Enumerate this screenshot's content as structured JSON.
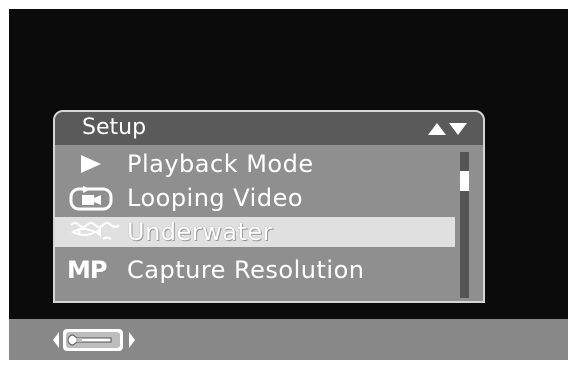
{
  "menu": {
    "title": "Setup",
    "scroll_icon": "up-down-triangles-icon",
    "items": [
      {
        "label": "Playback Mode",
        "icon": "play-icon"
      },
      {
        "label": "Looping Video",
        "icon": "looping-video-icon"
      },
      {
        "label": "Underwater",
        "icon": "underwater-fish-icon",
        "selected": true
      },
      {
        "label": "Capture Resolution",
        "icon": "megapixel-icon",
        "icon_text": "MP"
      }
    ],
    "scroll_position": 0.15
  },
  "bottom_bar": {
    "current_mode_icon": "wrench-setup-icon",
    "left_arrow_icon": "chevron-left-icon",
    "right_arrow_icon": "chevron-right-icon"
  },
  "colors": {
    "screen_bg": "#0b0b0b",
    "panel_bg": "#8f8f8f",
    "header_bg": "#5a5a5a",
    "selected_row": "#e0e0e0",
    "bottom_bar": "#888888"
  }
}
